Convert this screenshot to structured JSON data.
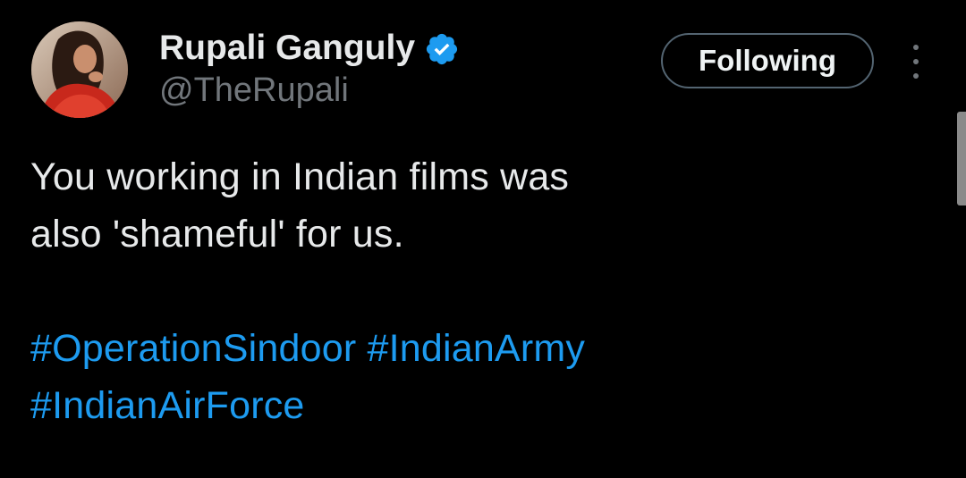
{
  "author": {
    "display_name": "Rupali Ganguly",
    "handle": "@TheRupali",
    "verified": true,
    "avatar_icon": "profile-photo"
  },
  "actions": {
    "follow_label": "Following",
    "more_icon": "more-vertical-icon"
  },
  "tweet": {
    "text_lines": [
      "You working in Indian films was",
      "also 'shameful' for us."
    ],
    "hashtags": [
      "#OperationSindoor",
      "#IndianArmy",
      "#IndianAirForce"
    ]
  },
  "colors": {
    "background": "#000000",
    "text": "#e7e9ea",
    "secondary_text": "#71767b",
    "link": "#1d9bf0",
    "verified_badge": "#1d9bf0"
  }
}
